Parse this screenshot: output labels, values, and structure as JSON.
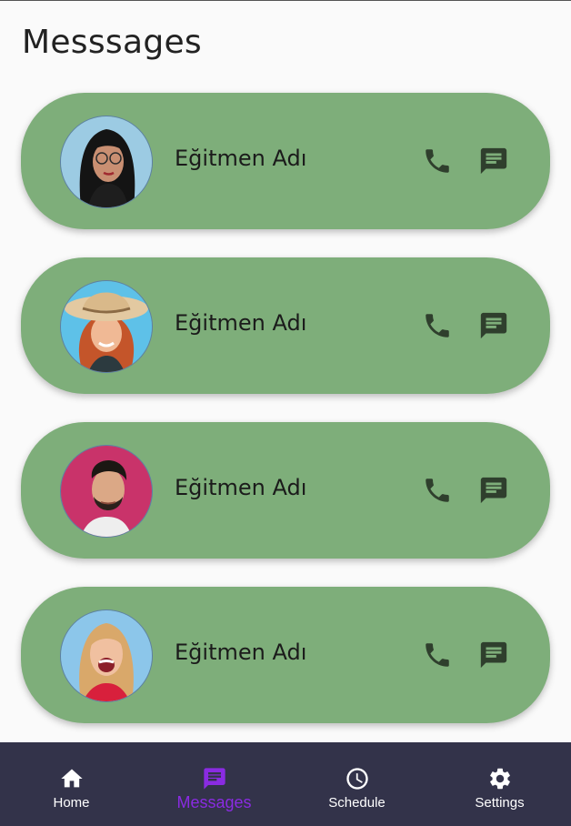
{
  "page": {
    "title": "Messsages"
  },
  "contacts": [
    {
      "name": "Eğitmen Adı",
      "avatar": "woman-glasses-avatar",
      "avatar_bg": "#9ccbe3"
    },
    {
      "name": "Eğitmen Adı",
      "avatar": "woman-hat-avatar",
      "avatar_bg": "#5ec1e8"
    },
    {
      "name": "Eğitmen Adı",
      "avatar": "man-beard-avatar",
      "avatar_bg": "#c9336a"
    },
    {
      "name": "Eğitmen Adı",
      "avatar": "woman-laughing-avatar",
      "avatar_bg": "#8cc6ea"
    }
  ],
  "nav": {
    "items": [
      {
        "label": "Home",
        "icon": "home-icon",
        "active": false
      },
      {
        "label": "Messages",
        "icon": "message-icon",
        "active": true
      },
      {
        "label": "Schedule",
        "icon": "clock-icon",
        "active": false
      },
      {
        "label": "Settings",
        "icon": "gear-icon",
        "active": false
      }
    ]
  },
  "colors": {
    "card_bg": "#7eae7a",
    "icon": "#2f3f2d",
    "nav_bg": "#33334a",
    "nav_active": "#8a2be2",
    "nav_text": "#ffffff"
  }
}
